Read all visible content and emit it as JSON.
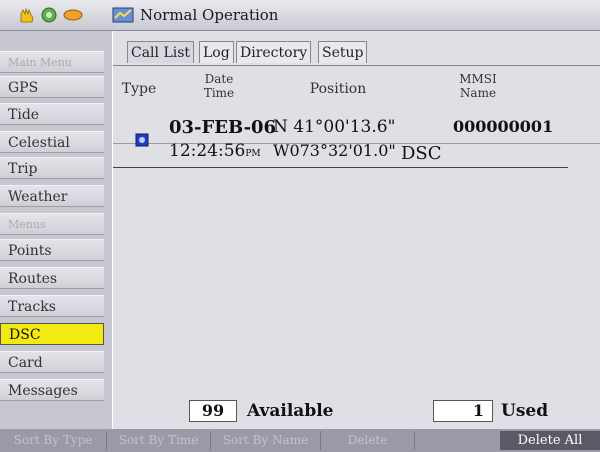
{
  "titlebar": {
    "title": "Normal Operation",
    "icons": [
      "yellow-hand-icon",
      "green-gear-icon",
      "orange-satellite-icon",
      "chart-icon"
    ]
  },
  "sidebar": {
    "items": [
      {
        "label": "Main Menu",
        "state": "dim"
      },
      {
        "label": "GPS",
        "state": "normal"
      },
      {
        "label": "Tide",
        "state": "normal"
      },
      {
        "label": "Celestial",
        "state": "normal"
      },
      {
        "label": "Trip",
        "state": "normal"
      },
      {
        "label": "Weather",
        "state": "normal"
      },
      {
        "label": "Menus",
        "state": "dim"
      },
      {
        "label": "Points",
        "state": "normal"
      },
      {
        "label": "Routes",
        "state": "normal"
      },
      {
        "label": "Tracks",
        "state": "normal"
      },
      {
        "label": "DSC",
        "state": "active"
      },
      {
        "label": "Card",
        "state": "normal"
      },
      {
        "label": "Messages",
        "state": "normal"
      }
    ]
  },
  "tabs": [
    {
      "label": "Call List",
      "active": true
    },
    {
      "label": "Log",
      "active": false
    },
    {
      "label": "Directory",
      "active": false
    },
    {
      "label": "Setup",
      "active": false
    }
  ],
  "table": {
    "headers": {
      "type": "Type",
      "date": "Date",
      "time": "Time",
      "position": "Position",
      "mmsi": "MMSI",
      "name": "Name"
    },
    "rows": [
      {
        "date": "03-FEB-06",
        "time": "12:24:56",
        "ampm": "PM",
        "lat": "N  41°00'13.6\"",
        "lon": "W073°32'01.0\"",
        "mmsi": "000000001",
        "name": "DSC"
      }
    ]
  },
  "footer": {
    "available_count": "99",
    "available_label": "Available",
    "used_count": "1",
    "used_label": "Used"
  },
  "softkeys": [
    {
      "label": "Sort By Type",
      "active": false
    },
    {
      "label": "Sort By Time",
      "active": false
    },
    {
      "label": "Sort By Name",
      "active": false
    },
    {
      "label": "Delete",
      "active": false
    },
    {
      "label": "Delete All",
      "active": true
    }
  ],
  "colors": {
    "selected_menu": "#f2ea10",
    "panel_bg": "#dfe0e6",
    "softkey_active": "#5a5a66"
  }
}
